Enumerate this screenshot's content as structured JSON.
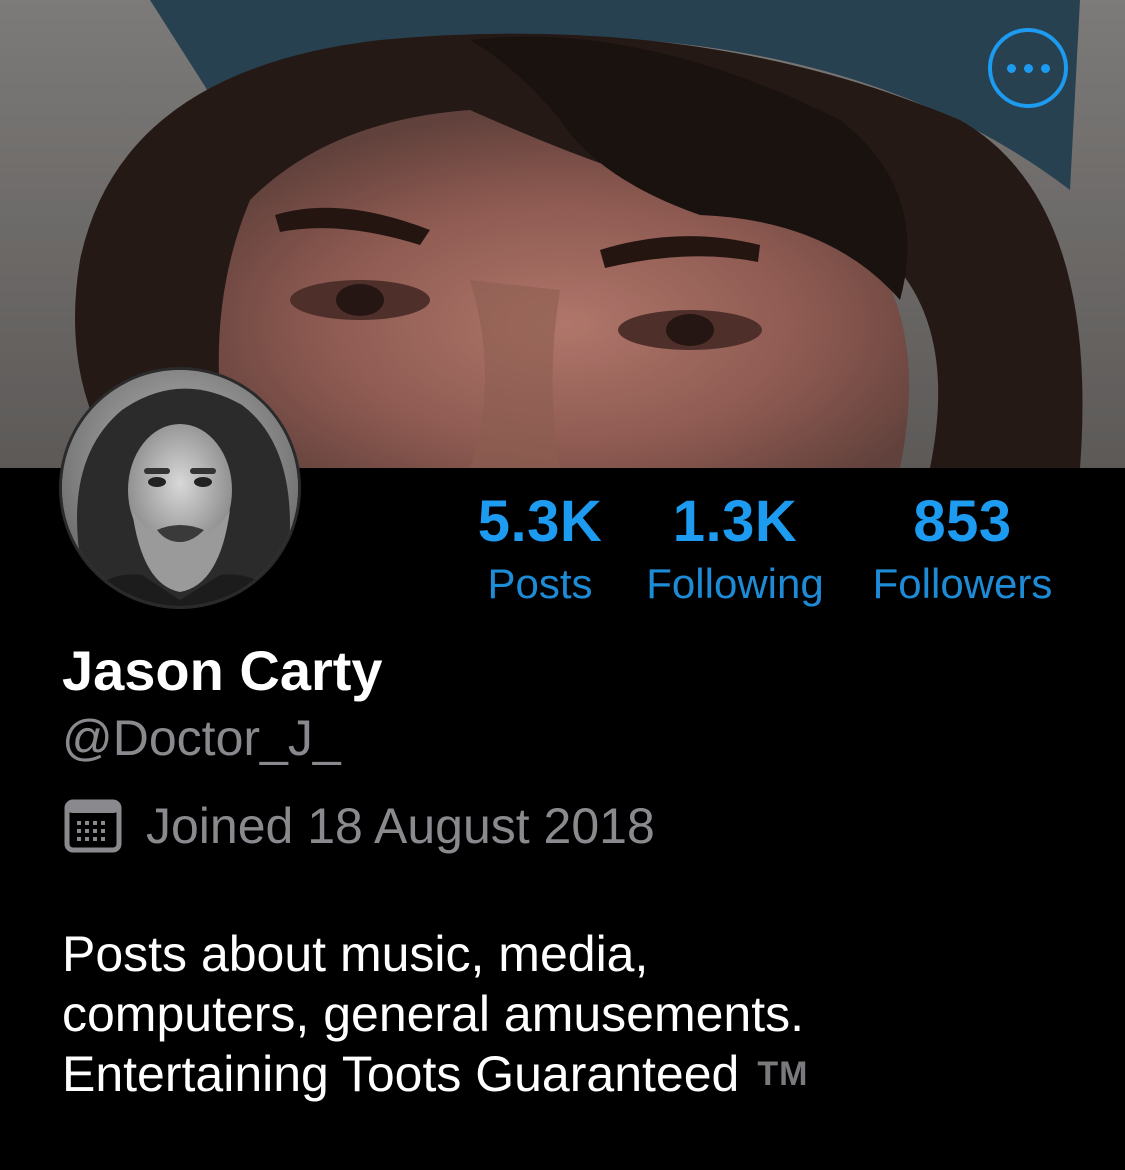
{
  "header": {
    "more_icon": "ellipsis-circle-icon",
    "accent_color": "#1d9bf0"
  },
  "profile": {
    "display_name": "Jason Carty",
    "handle": "@Doctor_J_",
    "joined_icon": "calendar-icon",
    "joined_text": "Joined 18 August 2018",
    "bio_lines": [
      "Posts about music, media,",
      "computers, general amusements.",
      "Entertaining Toots Guaranteed"
    ],
    "bio_trademark": "TM"
  },
  "stats": [
    {
      "value": "5.3K",
      "label": "Posts"
    },
    {
      "value": "1.3K",
      "label": "Following"
    },
    {
      "value": "853",
      "label": "Followers"
    }
  ]
}
